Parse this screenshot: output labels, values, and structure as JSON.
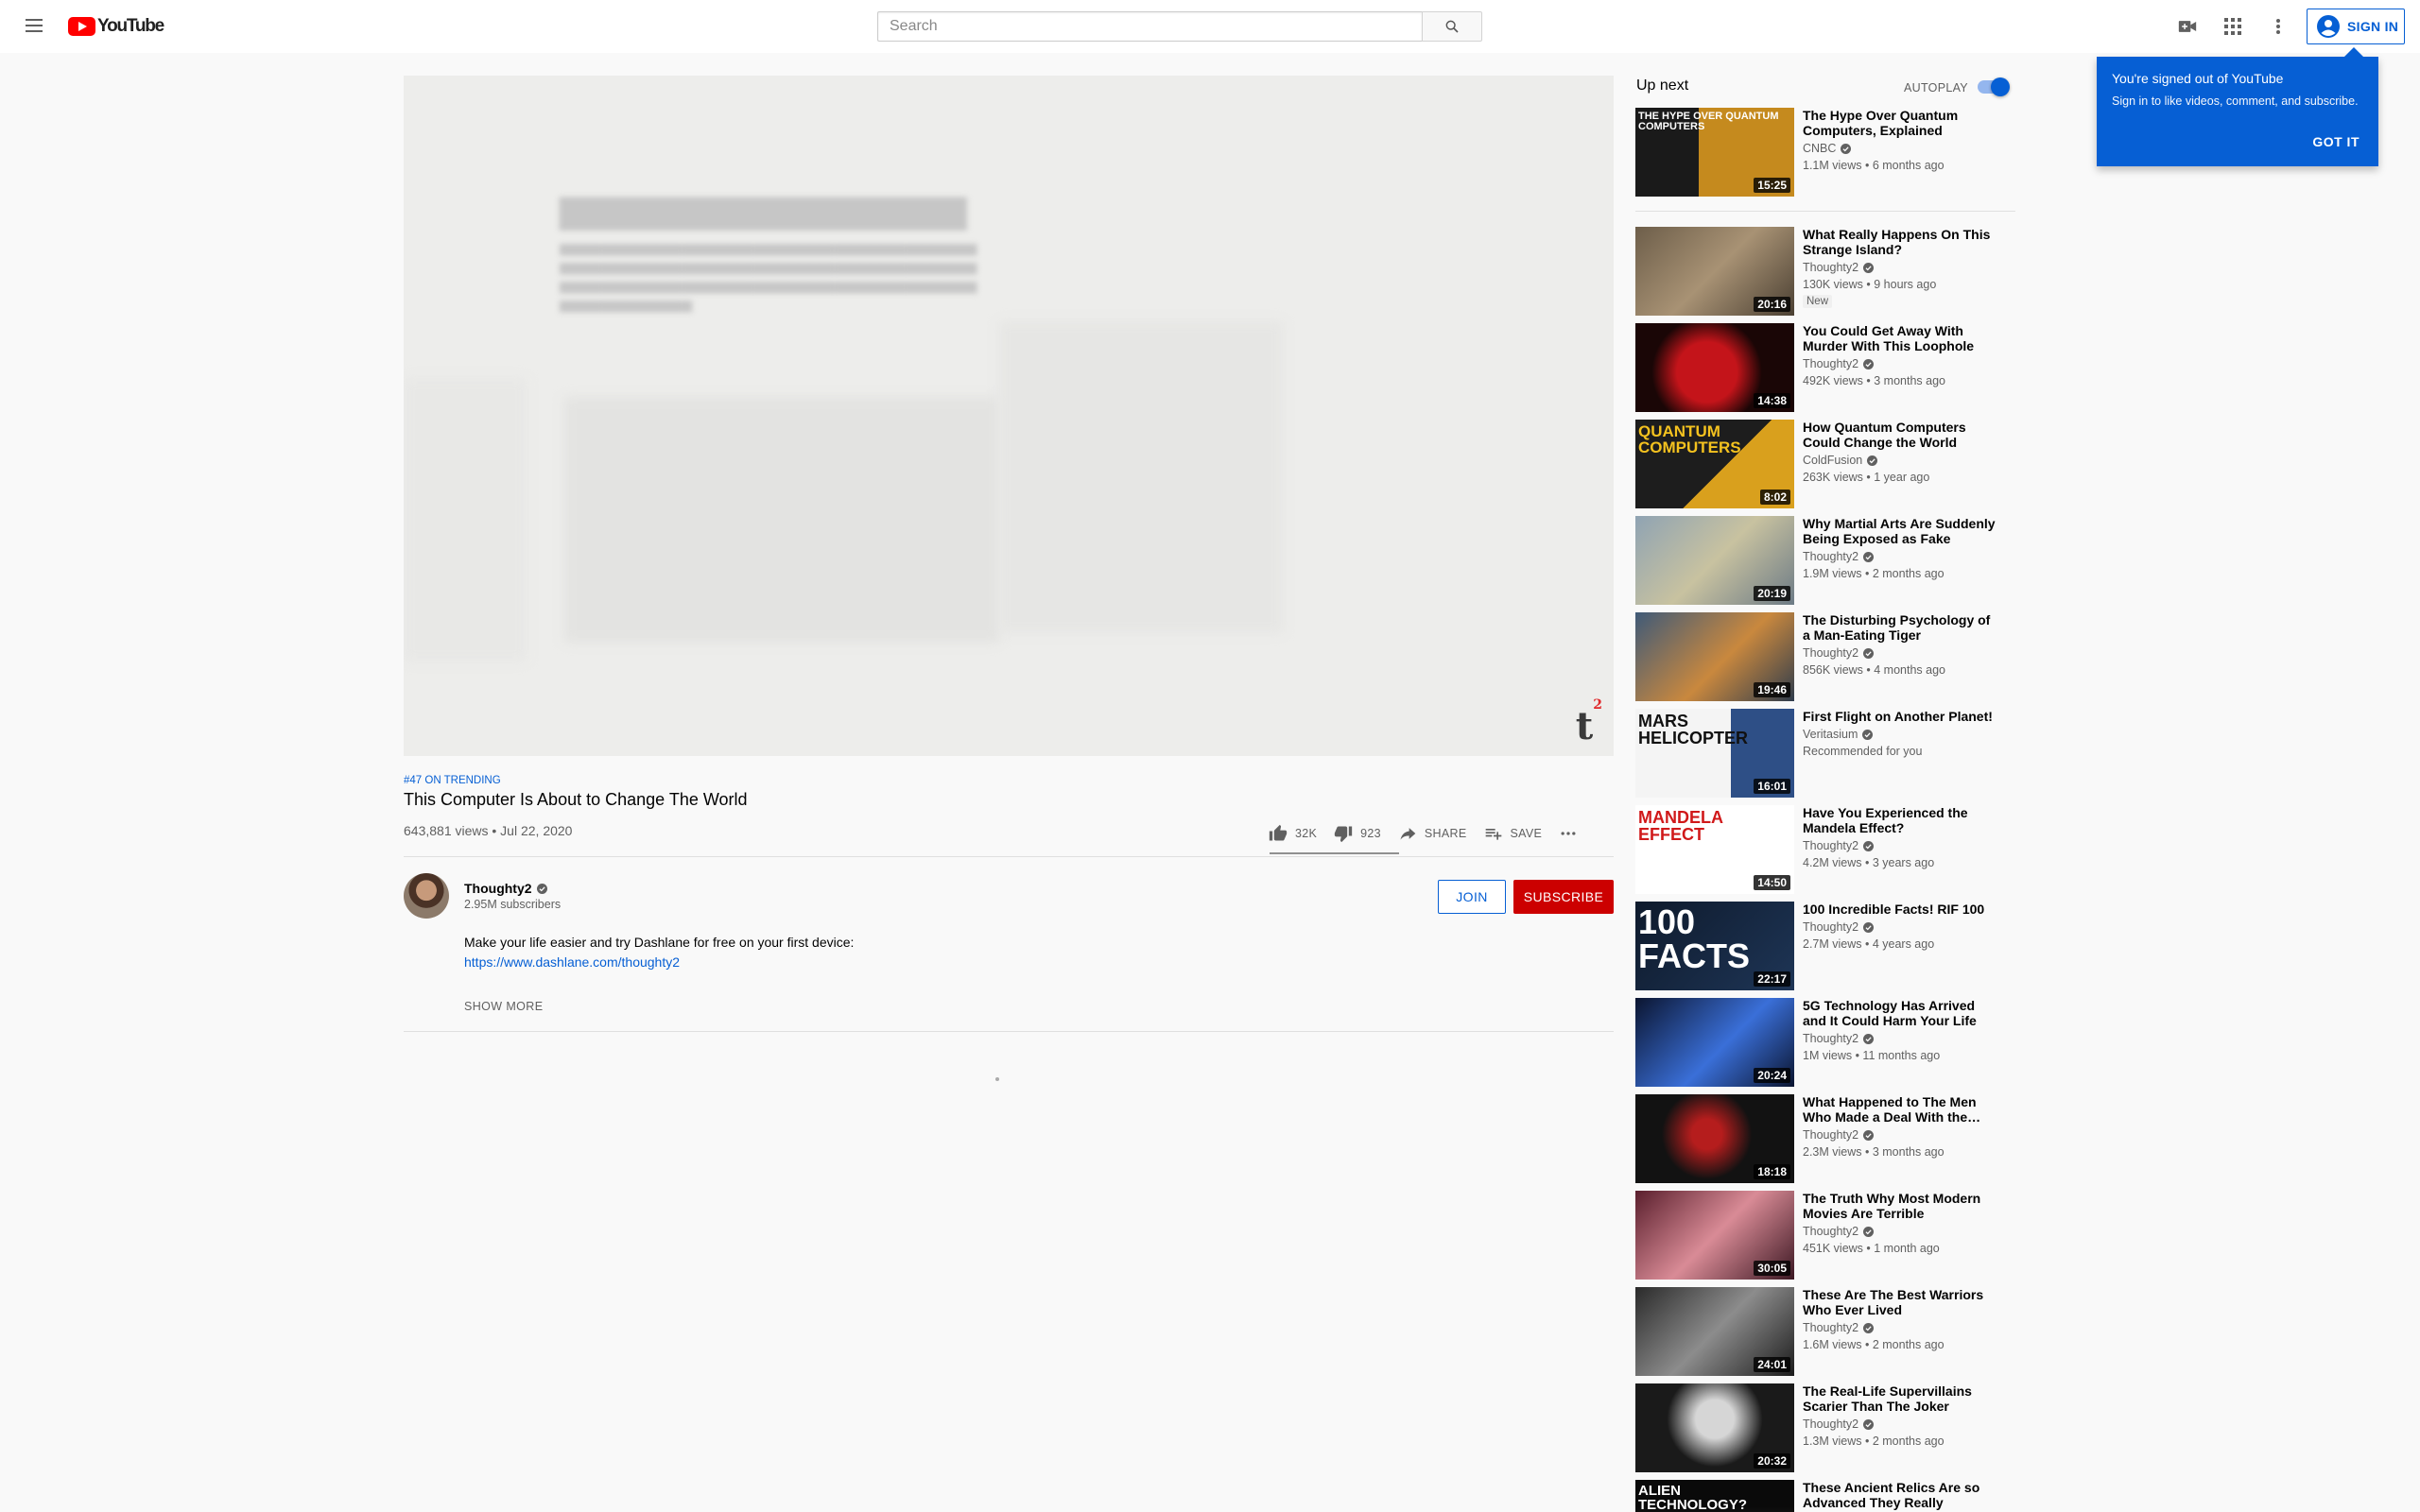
{
  "masthead": {
    "logo_text": "YouTube",
    "search_placeholder": "Search",
    "signin_label": "SIGN IN"
  },
  "popup": {
    "title": "You're signed out of YouTube",
    "body": "Sign in to like videos, comment, and subscribe.",
    "button": "GOT IT"
  },
  "player": {
    "watermark": "t",
    "watermark_sup": "2"
  },
  "video": {
    "trending": "#47 ON TRENDING",
    "title": "This Computer Is About to Change The World",
    "views_date": "643,881 views • Jul 22, 2020",
    "like_count": "32K",
    "dislike_count": "923",
    "like_fraction": 0.972,
    "share_label": "SHARE",
    "save_label": "SAVE"
  },
  "channel": {
    "name": "Thoughty2",
    "subscribers": "2.95M subscribers",
    "join_label": "JOIN",
    "subscribe_label": "SUBSCRIBE"
  },
  "description": {
    "line1": "Make your life easier and try Dashlane for free on your first device:",
    "link": "https://www.dashlane.com/thoughty2",
    "show_more": "SHOW MORE"
  },
  "upnext": {
    "title": "Up next",
    "autoplay_label": "AUTOPLAY",
    "autoplay_on": true,
    "items": [
      {
        "title": "The Hype Over Quantum Computers, Explained",
        "channel": "CNBC",
        "meta": "1.1M views • 6 months ago",
        "duration": "15:25",
        "thumb_text": "THE HYPE OVER QUANTUM COMPUTERS",
        "badge": ""
      },
      {
        "title": "What Really Happens On This Strange Island?",
        "channel": "Thoughty2",
        "meta": "130K views • 9 hours ago",
        "duration": "20:16",
        "thumb_text": "",
        "badge": "New"
      },
      {
        "title": "You Could Get Away With Murder With This Loophole",
        "channel": "Thoughty2",
        "meta": "492K views • 3 months ago",
        "duration": "14:38",
        "thumb_text": "",
        "badge": ""
      },
      {
        "title": "How Quantum Computers Could Change the World",
        "channel": "ColdFusion",
        "meta": "263K views • 1 year ago",
        "duration": "8:02",
        "thumb_text": "QUANTUM COMPUTERS",
        "badge": ""
      },
      {
        "title": "Why Martial Arts Are Suddenly Being Exposed as Fake",
        "channel": "Thoughty2",
        "meta": "1.9M views • 2 months ago",
        "duration": "20:19",
        "thumb_text": "",
        "badge": ""
      },
      {
        "title": "The Disturbing Psychology of a Man-Eating Tiger",
        "channel": "Thoughty2",
        "meta": "856K views • 4 months ago",
        "duration": "19:46",
        "thumb_text": "",
        "badge": ""
      },
      {
        "title": "First Flight on Another Planet!",
        "channel": "Veritasium",
        "meta": "Recommended for you",
        "duration": "16:01",
        "thumb_text": "MARS HELICOPTER",
        "badge": ""
      },
      {
        "title": "Have You Experienced the Mandela Effect?",
        "channel": "Thoughty2",
        "meta": "4.2M views • 3 years ago",
        "duration": "14:50",
        "thumb_text": "MANDELA EFFECT",
        "badge": ""
      },
      {
        "title": "100 Incredible Facts! RIF 100",
        "channel": "Thoughty2",
        "meta": "2.7M views • 4 years ago",
        "duration": "22:17",
        "thumb_text": "100 FACTS",
        "badge": ""
      },
      {
        "title": "5G Technology Has Arrived and It Could Harm Your Life",
        "channel": "Thoughty2",
        "meta": "1M views • 11 months ago",
        "duration": "20:24",
        "thumb_text": "",
        "badge": ""
      },
      {
        "title": "What Happened to The Men Who Made a Deal With the…",
        "channel": "Thoughty2",
        "meta": "2.3M views • 3 months ago",
        "duration": "18:18",
        "thumb_text": "",
        "badge": ""
      },
      {
        "title": "The Truth Why Most Modern Movies Are Terrible",
        "channel": "Thoughty2",
        "meta": "451K views • 1 month ago",
        "duration": "30:05",
        "thumb_text": "",
        "badge": ""
      },
      {
        "title": "These Are The Best Warriors Who Ever Lived",
        "channel": "Thoughty2",
        "meta": "1.6M views • 2 months ago",
        "duration": "24:01",
        "thumb_text": "",
        "badge": ""
      },
      {
        "title": "The Real-Life Supervillains Scarier Than The Joker",
        "channel": "Thoughty2",
        "meta": "1.3M views • 2 months ago",
        "duration": "20:32",
        "thumb_text": "",
        "badge": ""
      },
      {
        "title": "These Ancient Relics Are so Advanced They Really Should…",
        "channel": "",
        "meta": "",
        "duration": "",
        "thumb_text": "ALIEN TECHNOLOGY?",
        "badge": ""
      }
    ]
  },
  "colors": {
    "brand_red": "#ff0000",
    "subscribe_red": "#cc0000",
    "link_blue": "#065fd4"
  }
}
